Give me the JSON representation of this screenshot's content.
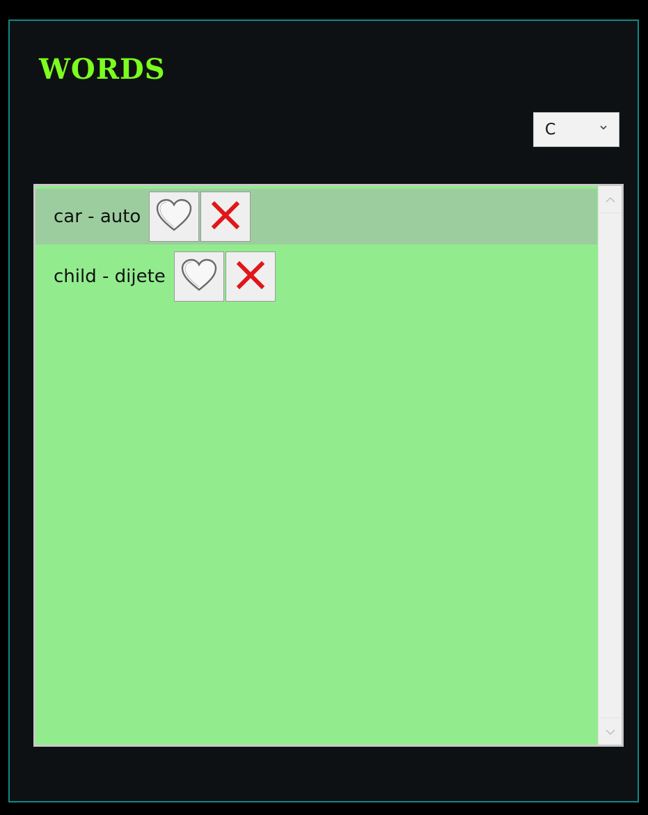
{
  "window": {
    "title": "WORDS",
    "accent_color": "#7cff1e",
    "border_color": "#0f8a86"
  },
  "letter_select": {
    "selected": "C"
  },
  "word_list": {
    "background_color": "#92ec8e",
    "items": [
      {
        "label": "car - auto",
        "selected": true,
        "favorite_icon": "heart-outline-icon",
        "delete_icon": "close-icon"
      },
      {
        "label": "child - dijete",
        "selected": false,
        "favorite_icon": "heart-outline-icon",
        "delete_icon": "close-icon"
      }
    ]
  }
}
